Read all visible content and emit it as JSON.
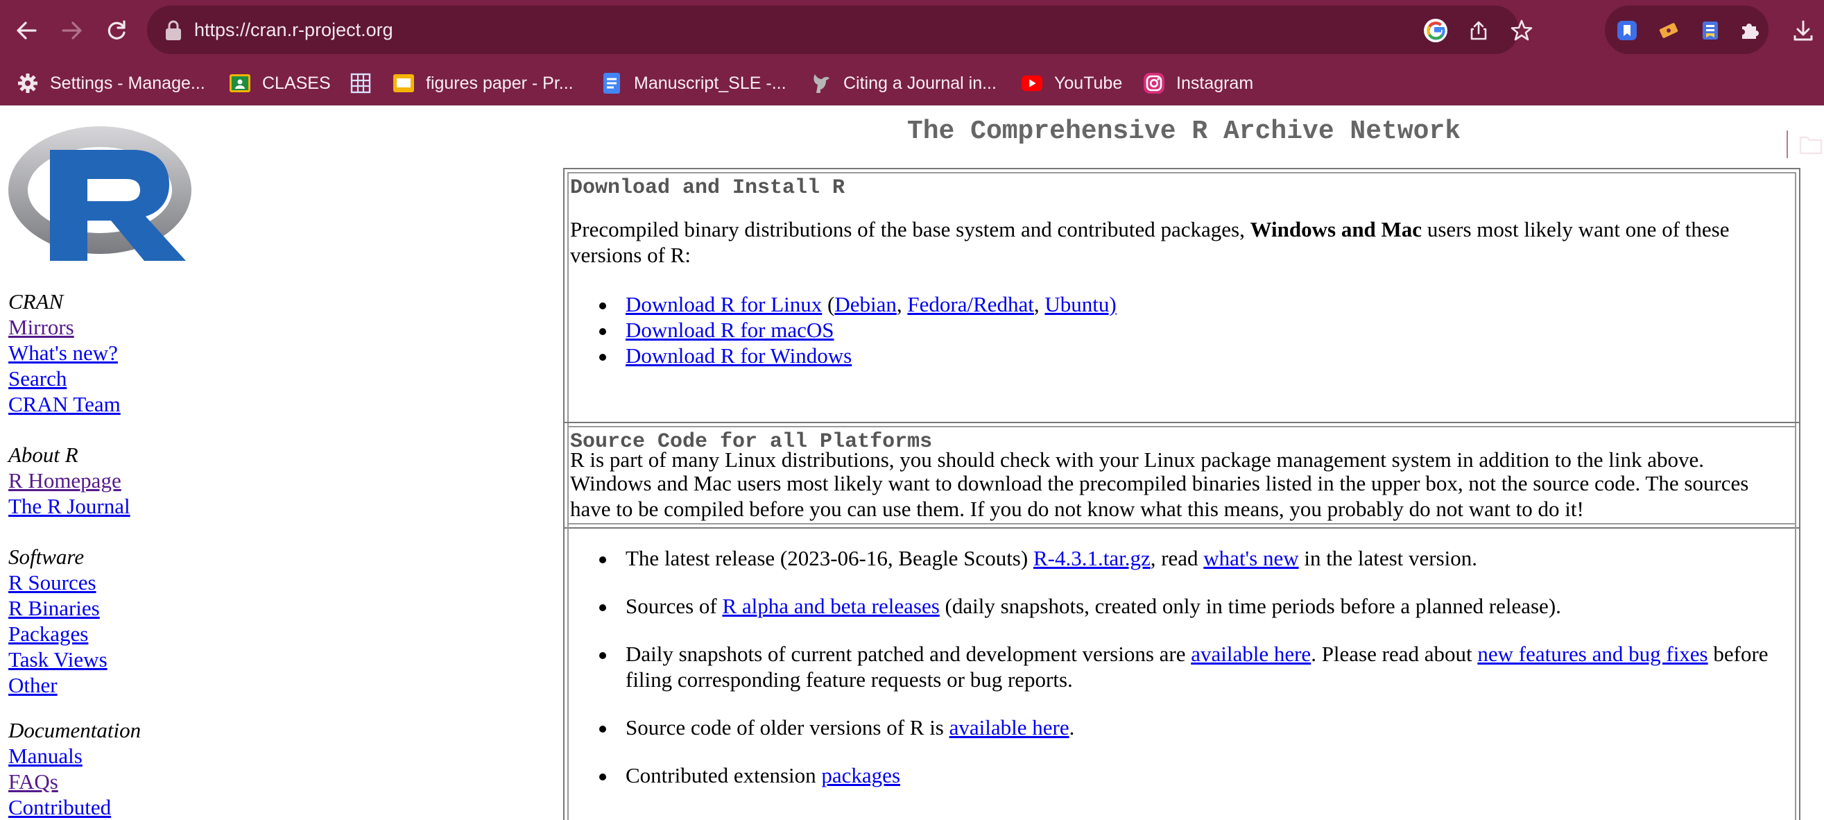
{
  "browser": {
    "url": "https://cran.r-project.org",
    "bookmarks": [
      {
        "label": "Settings - Manage...",
        "icon": "gear-icon"
      },
      {
        "label": "CLASES",
        "icon": "classroom-icon"
      },
      {
        "label": "",
        "icon": "sheets-icon"
      },
      {
        "label": "figures paper - Pr...",
        "icon": "slides-icon"
      },
      {
        "label": "Manuscript_SLE -...",
        "icon": "docs-icon"
      },
      {
        "label": "Citing a Journal in...",
        "icon": "bird-icon"
      },
      {
        "label": "YouTube",
        "icon": "youtube-icon"
      },
      {
        "label": "Instagram",
        "icon": "instagram-icon"
      }
    ]
  },
  "page": {
    "title": "The Comprehensive R Archive Network",
    "sidebar": {
      "cran": {
        "heading": "CRAN",
        "links": [
          "Mirrors",
          "What's new?",
          "Search",
          "CRAN Team"
        ]
      },
      "about": {
        "heading": "About R",
        "links": [
          "R Homepage",
          "The R Journal"
        ]
      },
      "software": {
        "heading": "Software",
        "links": [
          "R Sources",
          "R Binaries",
          "Packages",
          "Task Views",
          "Other"
        ]
      },
      "documentation": {
        "heading": "Documentation",
        "links": [
          "Manuals",
          "FAQs",
          "Contributed"
        ]
      }
    },
    "download_box": {
      "heading": "Download and Install R",
      "intro_pre": "Precompiled binary distributions of the base system and contributed packages, ",
      "intro_bold": "Windows and Mac",
      "intro_post": " users most likely want one of these versions of R:",
      "linux_link": "Download R for Linux",
      "open_paren": " (",
      "debian": "Debian",
      "comma": ", ",
      "fedora": "Fedora/Redhat",
      "ubuntu": "Ubuntu)",
      "macos_link": "Download R for macOS",
      "windows_link": "Download R for Windows",
      "footer": "R is part of many Linux distributions, you should check with your Linux package management system in addition to the link above."
    },
    "source_box": {
      "heading": "Source Code for all Platforms",
      "intro": "Windows and Mac users most likely want to download the precompiled binaries listed in the upper box, not the source code. The sources have to be compiled before you can use them. If you do not know what this means, you probably do not want to do it!",
      "item1_pre": "The latest release (2023-06-16, Beagle Scouts) ",
      "item1_link1": "R-4.3.1.tar.gz",
      "item1_mid": ", read ",
      "item1_link2": "what's new",
      "item1_post": " in the latest version.",
      "item2_pre": "Sources of ",
      "item2_link": "R alpha and beta releases",
      "item2_post": " (daily snapshots, created only in time periods before a planned release).",
      "item3_pre": "Daily snapshots of current patched and development versions are ",
      "item3_link1": "available here",
      "item3_mid": ". Please read about ",
      "item3_link2": "new features and bug fixes",
      "item3_post": " before filing corresponding feature requests or bug reports.",
      "item4_pre": "Source code of older versions of R is ",
      "item4_link": "available here",
      "item4_post": ".",
      "item5_pre": "Contributed extension ",
      "item5_link": "packages"
    }
  }
}
